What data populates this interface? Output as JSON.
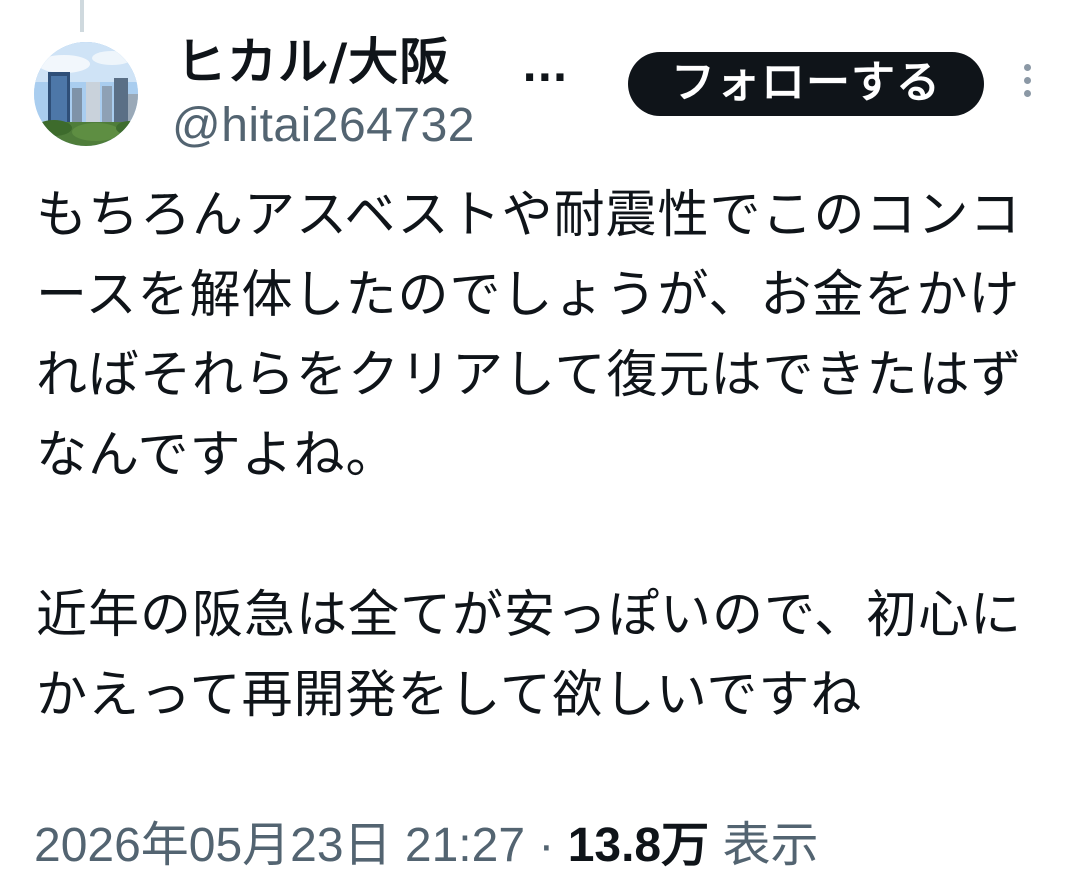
{
  "tweet": {
    "author": {
      "display_name": "ヒカル/大阪",
      "name_truncation": "...",
      "handle": "@hitai264732",
      "avatar_icon": "city-skyline-avatar"
    },
    "follow_label": "フォローする",
    "more_icon": "more-vertical-icon",
    "body": {
      "paragraph_1": "もちろんアスベストや耐震性でこのコンコースを解体したのでしょうが、お金をかければそれらをクリアして復元はできたはずなんですよね。",
      "paragraph_2": "近年の阪急は全てが安っぽいので、初心にかえって再開発をして欲しいですね"
    },
    "timestamp": "2026年05月23日 21:27",
    "separator": "·",
    "view_count": "13.8万",
    "view_label": "表示"
  },
  "colors": {
    "text_primary": "#0f1419",
    "text_secondary": "#536471",
    "button_bg": "#0f1419",
    "button_text": "#ffffff",
    "thread_line": "#cfd9de"
  }
}
